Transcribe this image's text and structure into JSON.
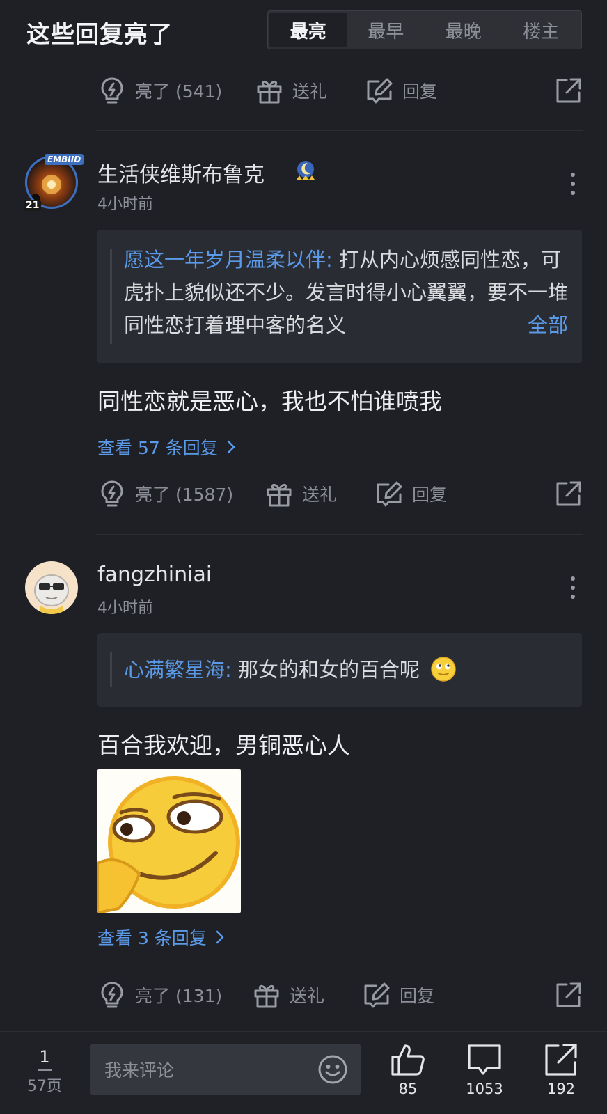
{
  "header": {
    "title": "这些回复亮了",
    "tabs": [
      "最亮",
      "最早",
      "最晚",
      "楼主"
    ],
    "active_tab": "最亮"
  },
  "top_actions": {
    "light": "亮了 (541)",
    "gift": "送礼",
    "reply": "回复"
  },
  "comments": [
    {
      "username": "生活侠维斯布鲁克",
      "time": "4小时前",
      "avatar_text": "EMBIID",
      "avatar_number": "21",
      "quote_author": "愿这一年岁月温柔以伴:",
      "quote_text": " 打从内心烦感同性恋，可虎扑上貌似还不少。发言时得小心翼翼，要不一堆同性恋打着理中客的名义",
      "quote_more": "全部",
      "content": "同性恋就是恶心，我也不怕谁喷我",
      "view_replies": "查看 57 条回复",
      "light": "亮了 (1587)",
      "gift": "送礼",
      "reply": "回复"
    },
    {
      "username": "fangzhiniai",
      "time": "4小时前",
      "quote_author": "心满繁星海:",
      "quote_text": " 那女的和女的百合呢",
      "content": "百合我欢迎，男铜恶心人",
      "view_replies": "查看 3 条回复",
      "light": "亮了 (131)",
      "gift": "送礼",
      "reply": "回复"
    }
  ],
  "footer": {
    "page_current": "1",
    "page_total": "57页",
    "input_placeholder": "我来评论",
    "likes": "85",
    "comments": "1053",
    "shares": "192"
  },
  "icons": {
    "light": "lightbulb-icon",
    "gift": "gift-icon",
    "reply": "edit-icon",
    "share": "share-icon",
    "more": "more-vertical-icon",
    "like": "thumb-up-icon",
    "comment": "comment-bubble-icon",
    "emoji": "emoji-icon"
  },
  "colors": {
    "background": "#1f2026",
    "accent": "#5b9ae8",
    "muted": "#8c8f98"
  }
}
